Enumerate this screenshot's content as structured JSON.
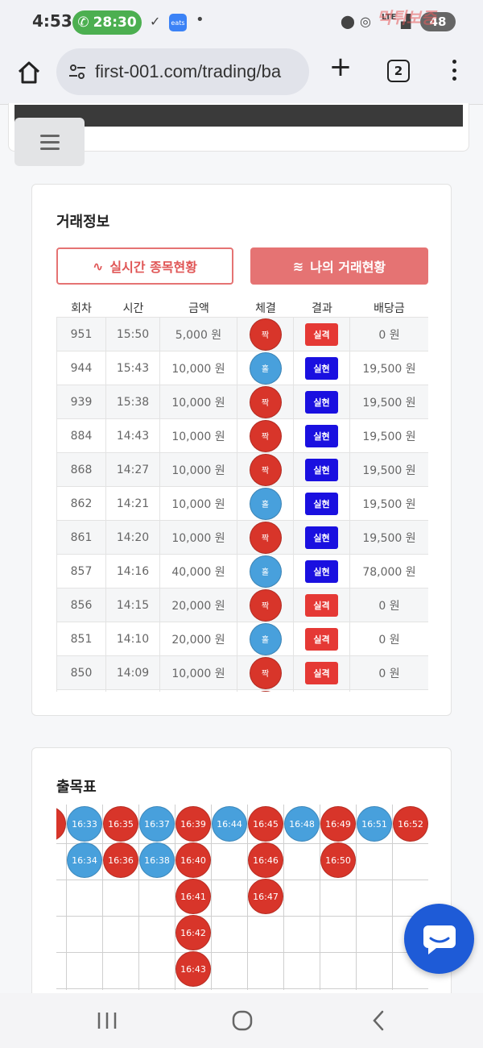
{
  "status_bar": {
    "time": "4:53",
    "call_timer": "28:30",
    "eats_label": "eats",
    "network": "LTE",
    "battery": "48",
    "watermark": "먹튀보증"
  },
  "browser": {
    "url": "first-001.com/trading/ba",
    "tab_count": "2"
  },
  "trade_info": {
    "title": "거래정보",
    "btn_live": "실시간 종목현황",
    "btn_mine": "나의 거래현황",
    "columns": [
      "회차",
      "시간",
      "금액",
      "체결",
      "결과",
      "배당금"
    ],
    "rows": [
      {
        "round": "951",
        "time": "15:50",
        "amount": "5,000 원",
        "pick": "짝",
        "pick_color": "red",
        "result": "실격",
        "result_type": "fail",
        "payout": "0 원"
      },
      {
        "round": "944",
        "time": "15:43",
        "amount": "10,000 원",
        "pick": "홀",
        "pick_color": "blue",
        "result": "실현",
        "result_type": "win",
        "payout": "19,500 원"
      },
      {
        "round": "939",
        "time": "15:38",
        "amount": "10,000 원",
        "pick": "짝",
        "pick_color": "red",
        "result": "실현",
        "result_type": "win",
        "payout": "19,500 원"
      },
      {
        "round": "884",
        "time": "14:43",
        "amount": "10,000 원",
        "pick": "짝",
        "pick_color": "red",
        "result": "실현",
        "result_type": "win",
        "payout": "19,500 원"
      },
      {
        "round": "868",
        "time": "14:27",
        "amount": "10,000 원",
        "pick": "짝",
        "pick_color": "red",
        "result": "실현",
        "result_type": "win",
        "payout": "19,500 원"
      },
      {
        "round": "862",
        "time": "14:21",
        "amount": "10,000 원",
        "pick": "홀",
        "pick_color": "blue",
        "result": "실현",
        "result_type": "win",
        "payout": "19,500 원"
      },
      {
        "round": "861",
        "time": "14:20",
        "amount": "10,000 원",
        "pick": "짝",
        "pick_color": "red",
        "result": "실현",
        "result_type": "win",
        "payout": "19,500 원"
      },
      {
        "round": "857",
        "time": "14:16",
        "amount": "40,000 원",
        "pick": "홀",
        "pick_color": "blue",
        "result": "실현",
        "result_type": "win",
        "payout": "78,000 원"
      },
      {
        "round": "856",
        "time": "14:15",
        "amount": "20,000 원",
        "pick": "짝",
        "pick_color": "red",
        "result": "실격",
        "result_type": "fail",
        "payout": "0 원"
      },
      {
        "round": "851",
        "time": "14:10",
        "amount": "20,000 원",
        "pick": "홀",
        "pick_color": "blue",
        "result": "실격",
        "result_type": "fail",
        "payout": "0 원"
      },
      {
        "round": "850",
        "time": "14:09",
        "amount": "10,000 원",
        "pick": "짝",
        "pick_color": "red",
        "result": "실격",
        "result_type": "fail",
        "payout": "0 원"
      },
      {
        "round": "",
        "time": "",
        "amount": "",
        "pick": "",
        "pick_color": "red",
        "result": "",
        "result_type": "win",
        "payout": ""
      }
    ]
  },
  "result_board": {
    "title": "출목표",
    "columns": [
      {
        "color": "red",
        "items": [
          "2"
        ]
      },
      {
        "color": "blue",
        "items": [
          "16:33",
          "16:34"
        ]
      },
      {
        "color": "red",
        "items": [
          "16:35",
          "16:36"
        ]
      },
      {
        "color": "blue",
        "items": [
          "16:37",
          "16:38"
        ]
      },
      {
        "color": "red",
        "items": [
          "16:39",
          "16:40",
          "16:41",
          "16:42",
          "16:43"
        ]
      },
      {
        "color": "blue",
        "items": [
          "16:44"
        ]
      },
      {
        "color": "red",
        "items": [
          "16:45",
          "16:46",
          "16:47"
        ]
      },
      {
        "color": "blue",
        "items": [
          "16:48"
        ]
      },
      {
        "color": "red",
        "items": [
          "16:49",
          "16:50"
        ]
      },
      {
        "color": "blue",
        "items": [
          "16:51"
        ]
      },
      {
        "color": "red",
        "items": [
          "16:52"
        ]
      }
    ]
  },
  "colors": {
    "red": "#d8352a",
    "blue": "#48a0dc",
    "fail_badge": "#e53935",
    "win_badge": "#1a10e0",
    "accent": "#e57373"
  }
}
